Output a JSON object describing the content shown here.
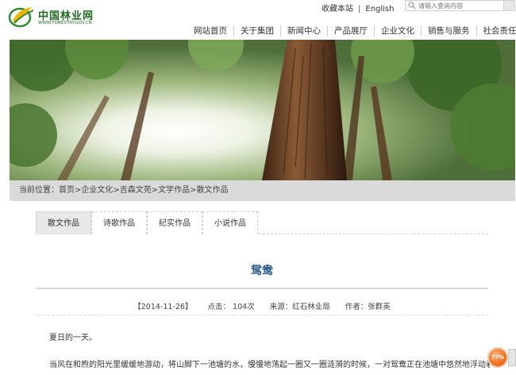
{
  "header": {
    "logo_cn": "中国林业网",
    "logo_en": "WWW.FORESTRY.GOV.CN",
    "toplinks": {
      "favorite": "收藏本站",
      "separator": "|",
      "english": "English"
    },
    "search": {
      "placeholder": "请输入查询内容"
    },
    "nav": [
      "网站首页",
      "关于集团",
      "新闻中心",
      "产品展厅",
      "企业文化",
      "销售与服务",
      "社会责任"
    ]
  },
  "breadcrumb": {
    "prefix": "当前位置：",
    "items": [
      "首页",
      ">企业文化",
      ">吉森文苑",
      ">文学作品",
      ">散文作品"
    ]
  },
  "tabs": [
    {
      "label": "散文作品",
      "active": true
    },
    {
      "label": "诗歌作品",
      "active": false
    },
    {
      "label": "纪实作品",
      "active": false
    },
    {
      "label": "小说作品",
      "active": false
    }
  ],
  "article": {
    "title": "鸳鸯",
    "meta": {
      "date": "【2014-11-26】",
      "clicks": "点击： 104次",
      "source": "来源：红石林业局",
      "author": "作者：张群英"
    },
    "paragraphs": [
      "夏日的一天。",
      "当风在和煦的阳光里缓缓地游动，将山脚下一池塘的水，慢慢地荡起一圈又一圈涟漪的时候，一对鸳鸯正在池塘中悠然地浮动着。偶"
    ]
  },
  "badge": {
    "text": "77%"
  },
  "colors": {
    "accent": "#2a5a8a",
    "breadcrumb_bg": "#dadada",
    "logo_green": "#1f6b1f",
    "badge": "#f06a1a"
  }
}
